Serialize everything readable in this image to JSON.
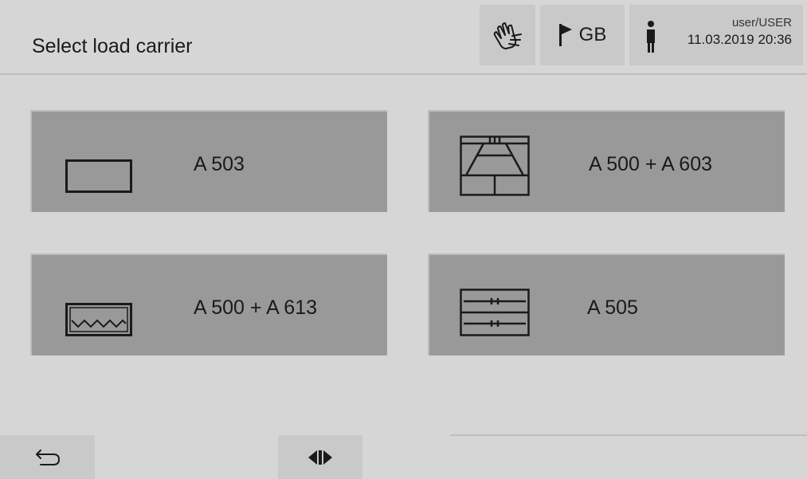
{
  "header": {
    "title": "Select load carrier",
    "buttons": {
      "hand_icon": "hand-touch-icon",
      "language": {
        "icon": "flag-icon",
        "label": "GB"
      },
      "user": {
        "icon": "person-icon",
        "name": "user/USER",
        "datetime": "11.03.2019 20:36"
      }
    }
  },
  "load_carriers": [
    {
      "label": "A 503",
      "icon": "basket-rectangle-icon"
    },
    {
      "label": "A 500 + A 603",
      "icon": "basket-insert-icon"
    },
    {
      "label": "A 500 + A 613",
      "icon": "basket-wave-icon"
    },
    {
      "label": "A 505",
      "icon": "basket-double-level-icon"
    }
  ],
  "footer": {
    "back_icon": "back-arrow-icon",
    "split_icon": "split-view-icon"
  },
  "colors": {
    "background": "#d6d6d6",
    "tile": "#999999",
    "button": "#c9c9c9"
  }
}
